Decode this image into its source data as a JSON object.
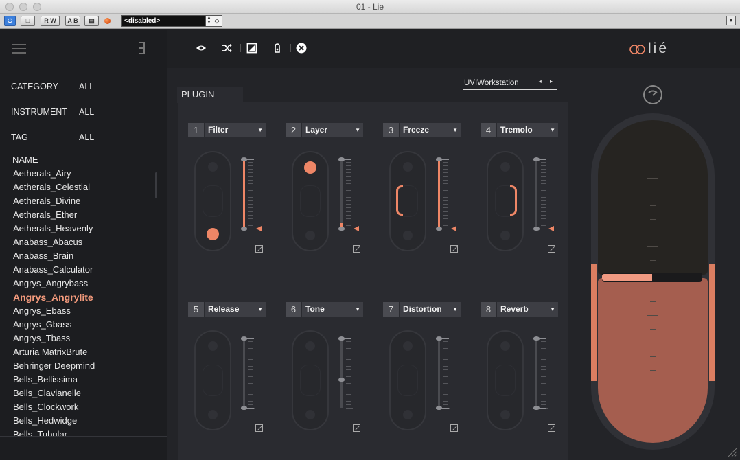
{
  "window": {
    "title": "01 - Lie"
  },
  "host": {
    "buttons": [
      "⏻",
      "□",
      "R W",
      "A B",
      "▤"
    ],
    "preset_select": "<disabled>"
  },
  "sidebar": {
    "filters": [
      {
        "label": "CATEGORY",
        "value": "ALL"
      },
      {
        "label": "INSTRUMENT",
        "value": "ALL"
      },
      {
        "label": "TAG",
        "value": "ALL"
      }
    ],
    "name_header": "NAME",
    "items": [
      "Aetherals_Airy",
      "Aetherals_Celestial",
      "Aetherals_Divine",
      "Aetherals_Ether",
      "Aetherals_Heavenly",
      "Anabass_Abacus",
      "Anabass_Brain",
      "Anabass_Calculator",
      "Angrys_Angrybass",
      "Angrys_Angrylite",
      "Angrys_Ebass",
      "Angrys_Gbass",
      "Angrys_Tbass",
      "Arturia MatrixBrute",
      "Behringer Deepmind",
      "Bells_Bellissima",
      "Bells_Clavianelle",
      "Bells_Clockwork",
      "Bells_Hedwidge",
      "Bells_Tubular"
    ],
    "selected_item": "Angrys_Angrylite"
  },
  "toolbar": {
    "icons": [
      "eye-icon",
      "shuffle-icon",
      "toggle-icon",
      "lock-icon",
      "close-icon"
    ]
  },
  "logo": {
    "text": "lié"
  },
  "plugin": {
    "label": "PLUGIN",
    "host_select": "UVIWorkstation",
    "arrows": "◂ ▸"
  },
  "modules": [
    {
      "num": "1",
      "name": "Filter",
      "slider_level": 1.0,
      "pad_dot": "bottom",
      "marker": true
    },
    {
      "num": "2",
      "name": "Layer",
      "slider_level": 0.08,
      "pad_dot": "top",
      "marker": true
    },
    {
      "num": "3",
      "name": "Freeze",
      "slider_level": 1.0,
      "pad_dot": "left-bracket",
      "marker": true
    },
    {
      "num": "4",
      "name": "Tremolo",
      "slider_level": 0.0,
      "pad_dot": "right-bracket",
      "marker": true
    },
    {
      "num": "5",
      "name": "Release",
      "slider_level": 0.0,
      "pad_dot": "none",
      "marker": false
    },
    {
      "num": "6",
      "name": "Tone",
      "slider_level": 0.4,
      "pad_dot": "none",
      "marker": false
    },
    {
      "num": "7",
      "name": "Distortion",
      "slider_level": 0.0,
      "pad_dot": "none",
      "marker": false
    },
    {
      "num": "8",
      "name": "Reverb",
      "slider_level": 0.0,
      "pad_dot": "none",
      "marker": false
    }
  ],
  "master": {
    "level": 0.5
  },
  "colors": {
    "accent": "#ee8666",
    "background": "#232428",
    "sidebar": "#1c1d20"
  }
}
